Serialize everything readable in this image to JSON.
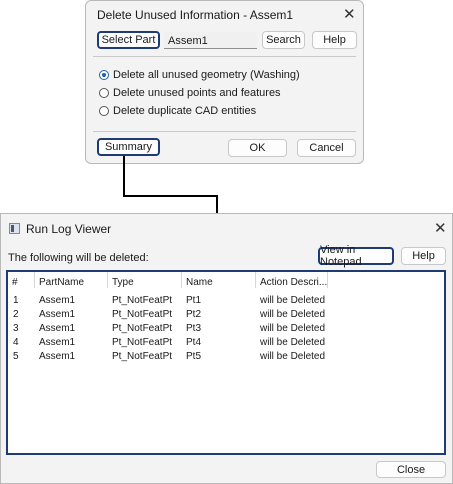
{
  "dialog1": {
    "title": "Delete Unused Information - Assem1",
    "select_part_label": "Select Part",
    "part_value": "Assem1",
    "search_label": "Search",
    "help_label": "Help",
    "options": [
      {
        "label": "Delete all unused geometry (Washing)",
        "selected": true
      },
      {
        "label": "Delete unused points and features",
        "selected": false
      },
      {
        "label": "Delete duplicate CAD entities",
        "selected": false
      }
    ],
    "summary_label": "Summary",
    "ok_label": "OK",
    "cancel_label": "Cancel"
  },
  "dialog2": {
    "title": "Run Log Viewer",
    "info_text": "The following will be deleted:",
    "view_notepad_label": "View in Notepad",
    "help_label": "Help",
    "columns": [
      "#",
      "PartName",
      "Type",
      "Name",
      "Action Descri..."
    ],
    "rows": [
      [
        "1",
        "Assem1",
        "Pt_NotFeatPt",
        "Pt1",
        "will be Deleted"
      ],
      [
        "2",
        "Assem1",
        "Pt_NotFeatPt",
        "Pt2",
        "will be Deleted"
      ],
      [
        "3",
        "Assem1",
        "Pt_NotFeatPt",
        "Pt3",
        "will be Deleted"
      ],
      [
        "4",
        "Assem1",
        "Pt_NotFeatPt",
        "Pt4",
        "will be Deleted"
      ],
      [
        "5",
        "Assem1",
        "Pt_NotFeatPt",
        "Pt5",
        "will be Deleted"
      ]
    ],
    "close_label": "Close"
  },
  "colors": {
    "focus_border": "#1f3b73",
    "radio_accent": "#1a5fb4"
  },
  "icons": {
    "close": "close-icon",
    "app": "run-log-app-icon"
  }
}
